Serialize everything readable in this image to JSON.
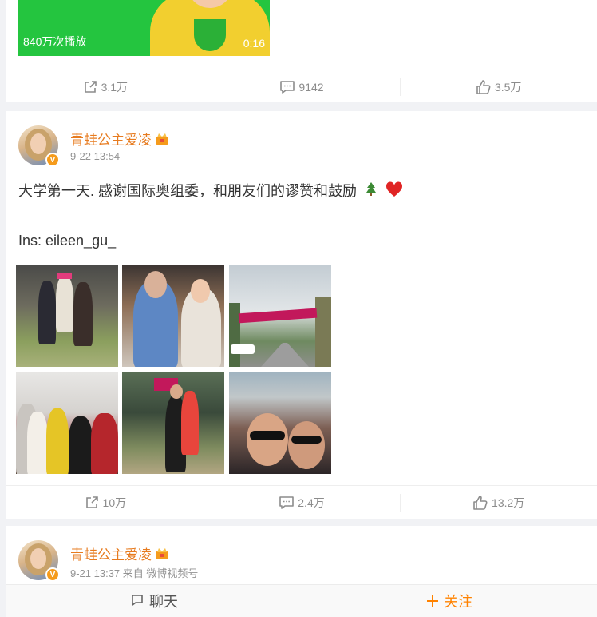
{
  "post1": {
    "video": {
      "plays": "840万次播放",
      "duration": "0:16"
    },
    "actions": {
      "repost": "3.1万",
      "comment": "9142",
      "like": "3.5万"
    }
  },
  "post2": {
    "username": "青蛙公主爱凌",
    "time": "9-22 13:54",
    "text": "大学第一天. 感谢国际奥组委，和朋友们的谬赞和鼓励",
    "emojis": [
      "tree-icon",
      "heart-icon"
    ],
    "ins_line": "Ins: eileen_gu_",
    "photos": [
      "photo-group-crowd",
      "photo-with-man",
      "photo-campus-banner",
      "photo-group-indoor",
      "photo-hug-outdoor",
      "photo-selfie-crowd"
    ],
    "actions": {
      "repost": "10万",
      "comment": "2.4万",
      "like": "13.2万"
    }
  },
  "post3": {
    "username": "青蛙公主爱凌",
    "time": "9-21 13:37 来自 微博视频号"
  },
  "footer": {
    "chat": "聊天",
    "follow": "关注"
  },
  "colors": {
    "accent": "#ff8200",
    "username": "#e77b1f",
    "muted": "#8c8c8c"
  }
}
